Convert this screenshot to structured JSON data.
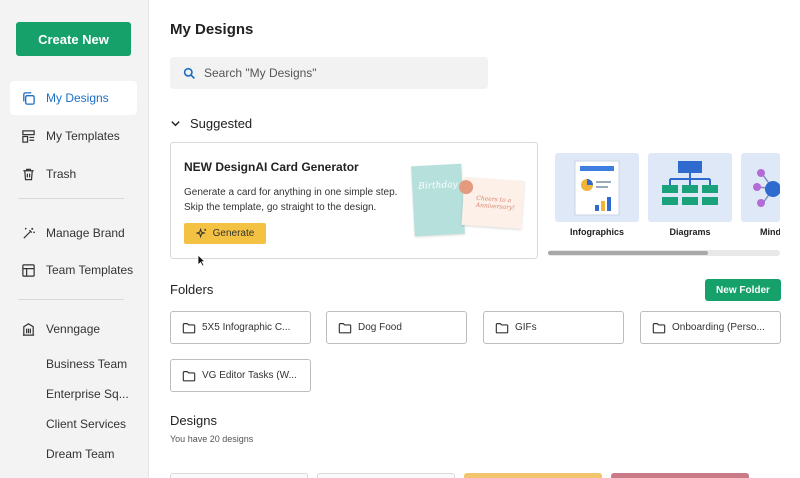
{
  "sidebar": {
    "create_label": "Create New",
    "nav": [
      {
        "label": "My Designs",
        "icon": "copy-icon",
        "active": true
      },
      {
        "label": "My Templates",
        "icon": "template-icon"
      },
      {
        "label": "Trash",
        "icon": "trash-icon"
      },
      {
        "label": "Manage Brand",
        "icon": "magic-wand-icon"
      },
      {
        "label": "Team Templates",
        "icon": "grid-icon"
      },
      {
        "label": "Venngage",
        "icon": "building-icon"
      }
    ],
    "teams": [
      "Business Team",
      "Enterprise Sq...",
      "Client Services",
      "Dream Team"
    ]
  },
  "main": {
    "title": "My Designs",
    "search_placeholder": "Search \"My Designs\"",
    "suggested_label": "Suggested",
    "generator": {
      "title": "NEW DesignAI Card Generator",
      "desc_line1": "Generate a card for anything in one simple step.",
      "desc_line2": "Skip the template, go straight to the design.",
      "button": "Generate",
      "card1_text": "Birthday",
      "card2_text": "Cheers to a Anniversary!"
    },
    "template_categories": [
      "Infographics",
      "Diagrams",
      "Mind"
    ],
    "folders_label": "Folders",
    "new_folder_label": "New Folder",
    "folders": [
      "5X5 Infographic C...",
      "Dog Food",
      "GIFs",
      "Onboarding (Perso...",
      "VG Editor Tasks (W..."
    ],
    "designs_label": "Designs",
    "designs_count": "You have 20 designs"
  },
  "colors": {
    "accent_green": "#16a06a",
    "active_blue": "#1c6fc4",
    "generate_yellow": "#f4c242"
  }
}
